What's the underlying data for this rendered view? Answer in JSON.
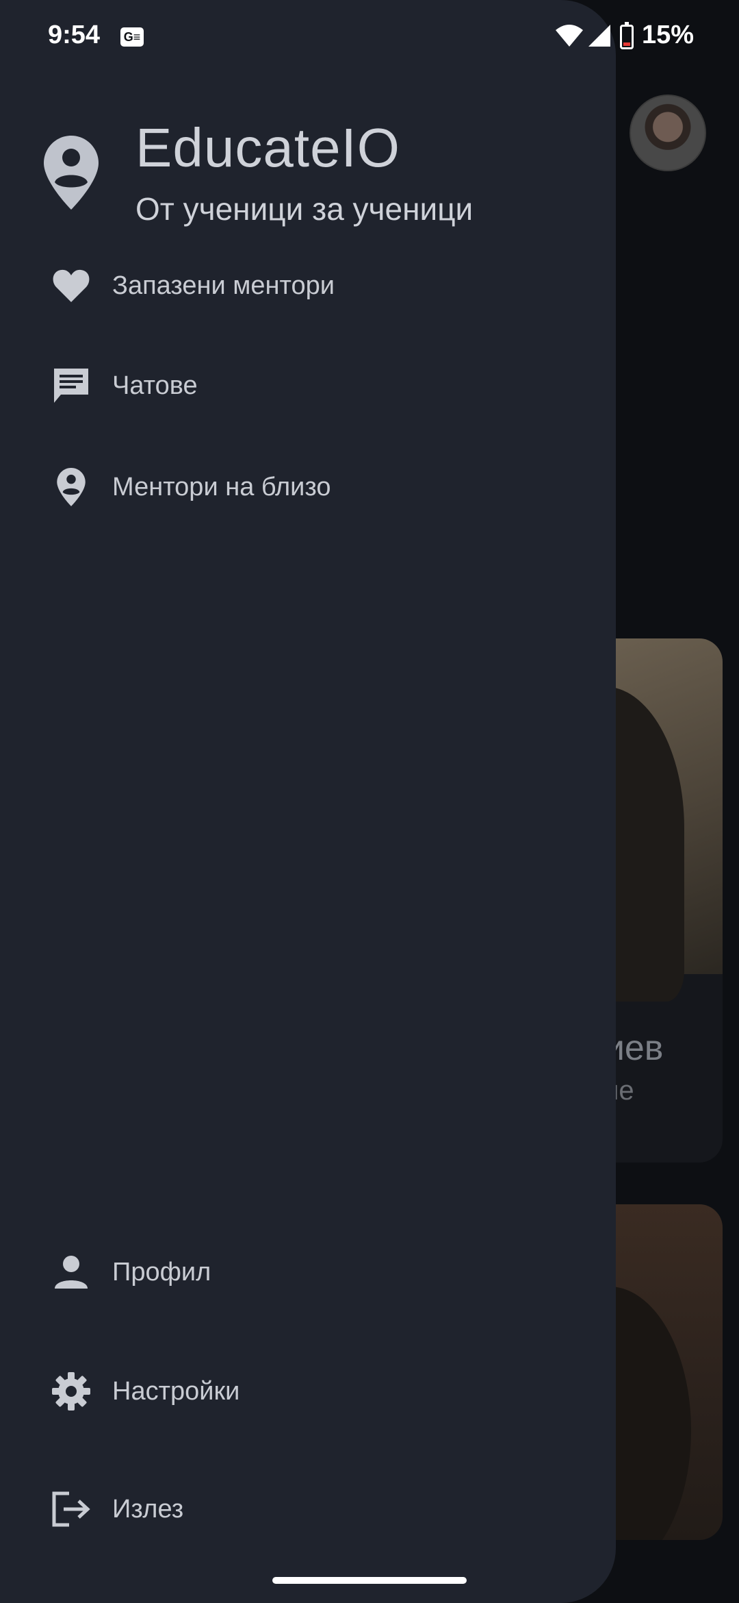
{
  "status_bar": {
    "time": "9:54",
    "notification_icon": "gallery-news-icon",
    "battery_percent": "15%"
  },
  "background": {
    "partial_name": "тиев",
    "partial_subtitle": "ане"
  },
  "drawer": {
    "header": {
      "icon": "person-pin-icon",
      "app_name": "EducateIO",
      "tagline": "От ученици за ученици"
    },
    "top_items": [
      {
        "label": "Запазени ментори",
        "icon": "heart-icon"
      },
      {
        "label": "Чатове",
        "icon": "chat-icon"
      },
      {
        "label": "Ментори на близо",
        "icon": "person-pin-icon"
      }
    ],
    "bottom_items": [
      {
        "label": "Профил",
        "icon": "person-icon"
      },
      {
        "label": "Настройки",
        "icon": "gear-icon"
      },
      {
        "label": "Излез",
        "icon": "logout-icon"
      }
    ]
  },
  "colors": {
    "drawer_bg": "#1f232d",
    "text": "#c9ccd3",
    "scrim_bg": "#0d0f13"
  }
}
